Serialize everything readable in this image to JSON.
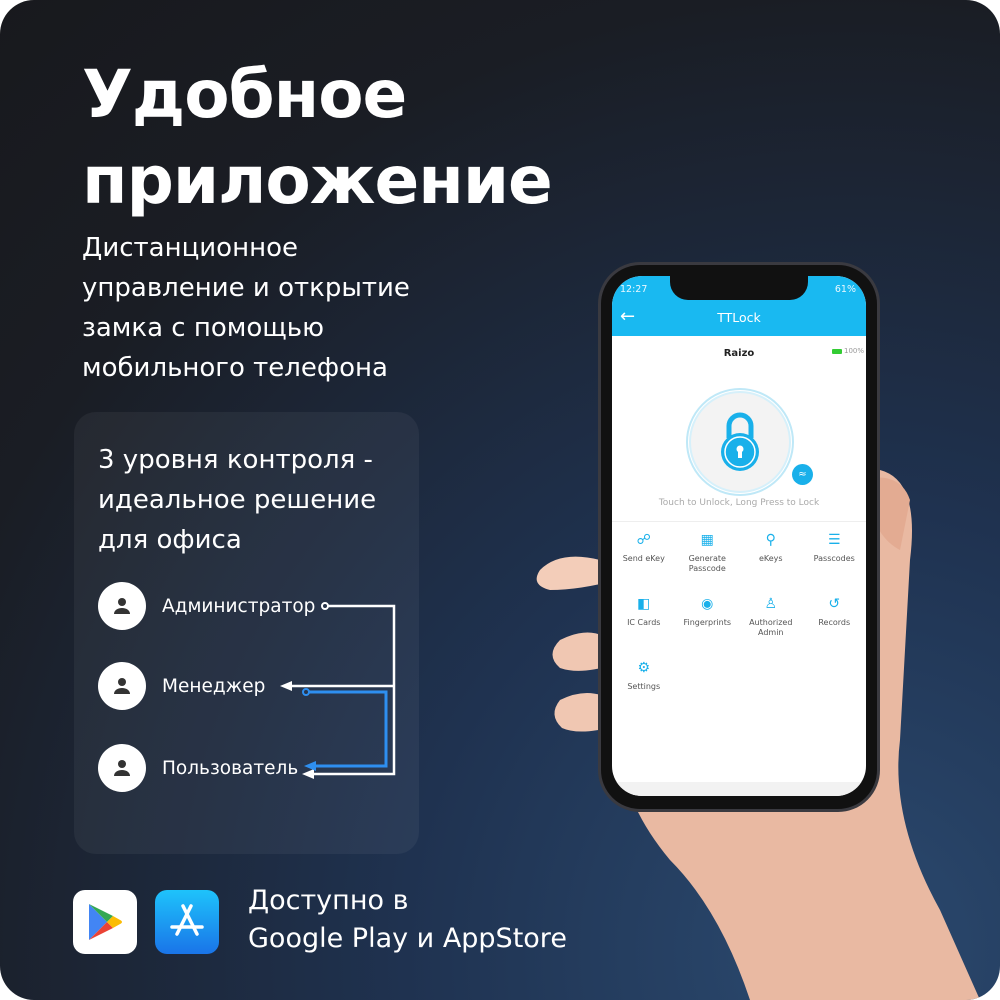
{
  "headline": {
    "line1": "Удобное",
    "line2": "приложение"
  },
  "subtitle": [
    "Дистанционное",
    "управление и открытие",
    "замка с помощью",
    "мобильного телефона"
  ],
  "card": {
    "title": [
      "3 уровня контроля -",
      "идеальное решение",
      "для офиса"
    ],
    "roles": [
      {
        "label": "Администратор",
        "icon": "user-icon"
      },
      {
        "label": "Менеджер",
        "icon": "user-icon"
      },
      {
        "label": "Пользователь",
        "icon": "user-icon"
      }
    ],
    "colors": {
      "admin_line": "#ffffff",
      "manager_line": "#2e8ff0"
    }
  },
  "availability": {
    "line1": "Доступно в",
    "line2": "Google Play и AppStore",
    "stores": [
      "google-play-icon",
      "app-store-icon"
    ]
  },
  "phone": {
    "status": {
      "time": "12:27",
      "battery": "61%"
    },
    "app_title": "TTLock",
    "lock_name": "Raizo",
    "lock_battery": "100%",
    "hint": "Touch to Unlock, Long Press to Lock",
    "accent": "#19b9f1",
    "menu": [
      {
        "label": "Send eKey",
        "icon": "send-key-icon"
      },
      {
        "label": "Generate\nPasscode",
        "icon": "keypad-icon"
      },
      {
        "label": "eKeys",
        "icon": "keys-icon"
      },
      {
        "label": "Passcodes",
        "icon": "list-icon"
      },
      {
        "label": "IC Cards",
        "icon": "card-icon"
      },
      {
        "label": "Fingerprints",
        "icon": "fingerprint-icon"
      },
      {
        "label": "Authorized\nAdmin",
        "icon": "admin-icon"
      },
      {
        "label": "Records",
        "icon": "history-icon"
      },
      {
        "label": "Settings",
        "icon": "gear-icon"
      }
    ]
  }
}
